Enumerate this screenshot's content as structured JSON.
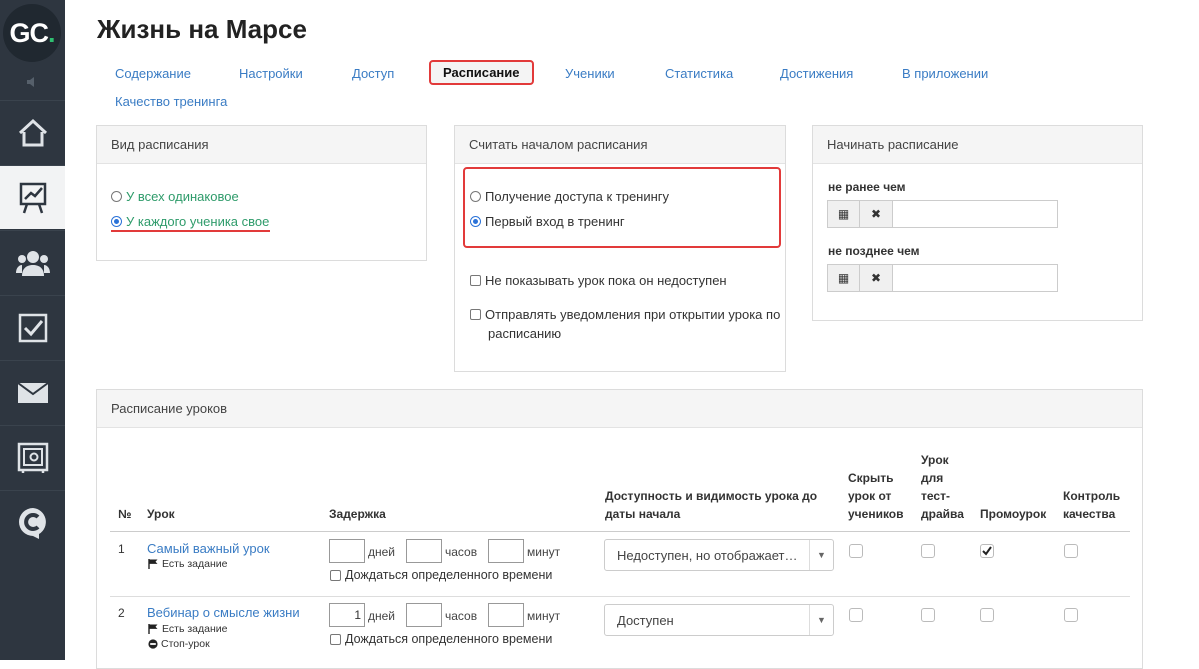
{
  "sidebar": {
    "logo_text": "GC",
    "logo_dot": ".",
    "items": [
      {
        "icon": "home-icon"
      },
      {
        "icon": "chart-icon"
      },
      {
        "icon": "users-icon"
      },
      {
        "icon": "tasks-icon"
      },
      {
        "icon": "mail-icon"
      },
      {
        "icon": "safe-icon"
      },
      {
        "icon": "chat-icon"
      }
    ]
  },
  "page": {
    "title": "Жизнь на Марсе"
  },
  "tabs": [
    {
      "label": "Содержание"
    },
    {
      "label": "Настройки"
    },
    {
      "label": "Доступ"
    },
    {
      "label": "Расписание"
    },
    {
      "label": "Ученики"
    },
    {
      "label": "Статистика"
    },
    {
      "label": "Достижения"
    },
    {
      "label": "В приложении"
    },
    {
      "label": "Качество тренинга"
    }
  ],
  "schedule_type": {
    "title": "Вид расписания",
    "options": [
      "У всех одинаковое",
      "У каждого ученика свое"
    ],
    "selected": "У каждого ученика свое"
  },
  "schedule_start": {
    "title": "Считать началом расписания",
    "options": [
      "Получение доступа к тренингу",
      "Первый вход в тренинг"
    ],
    "selected": "Первый вход в тренинг",
    "checkbox_hide": "Не показывать урок пока он недоступен",
    "checkbox_notify_1": "Отправлять уведомления при открытии урока по",
    "checkbox_notify_2": "расписанию"
  },
  "schedule_begin": {
    "title": "Начинать расписание",
    "not_before": "не ранее чем",
    "not_after": "не позднее чем",
    "calendar_glyph": "▦",
    "clear_glyph": "✖"
  },
  "lessons": {
    "title": "Расписание уроков",
    "headers": {
      "num": "№",
      "lesson": "Урок",
      "delay": "Задержка",
      "availability_1": "Доступность и видимость урока до",
      "availability_2": "даты начала",
      "hide_1": "Скрыть",
      "hide_2": "урок от",
      "hide_3": "учеников",
      "test_1": "Урок",
      "test_2": "для",
      "test_3": "тест-",
      "test_4": "драйва",
      "promo": "Промоурок",
      "quality_1": "Контроль",
      "quality_2": "качества"
    },
    "units": {
      "days": "дней",
      "hours": "часов",
      "minutes": "минут"
    },
    "wait_label": "Дождаться определенного времени",
    "rows": [
      {
        "num": "1",
        "name": "Самый важный урок",
        "tags": [
          "Есть задание"
        ],
        "days": "",
        "hours": "",
        "minutes": "",
        "availability": "Недоступен, но отображает…",
        "promo": true
      },
      {
        "num": "2",
        "name": "Вебинар о смысле жизни",
        "tags": [
          "Есть задание",
          "Стоп-урок"
        ],
        "days": "1",
        "hours": "",
        "minutes": "",
        "availability": "Доступен",
        "promo": false
      }
    ]
  },
  "colors": {
    "accent": "#3a7cc4",
    "highlight": "#e23a3a",
    "sidebar": "#2e3640",
    "green": "#2e9b6a"
  }
}
